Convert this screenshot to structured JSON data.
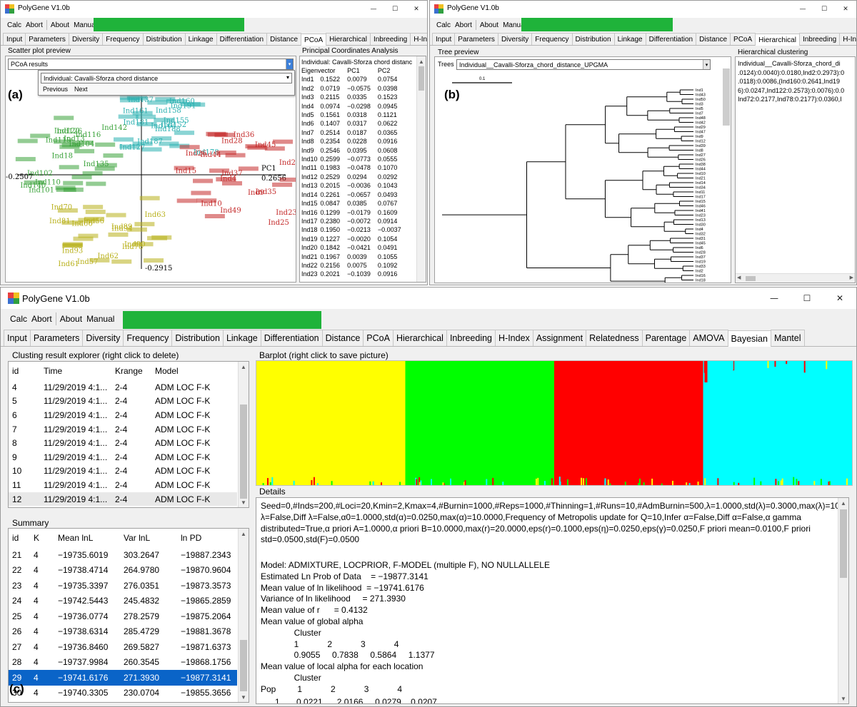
{
  "app_title": "PolyGene V1.0b",
  "menu": {
    "calc": "Calc",
    "abort": "Abort",
    "about": "About",
    "manual": "Manual"
  },
  "window_controls": {
    "minimize": "—",
    "maximize": "☐",
    "close": "✕"
  },
  "tabs_small_a": [
    "Input",
    "Parameters",
    "Diversity",
    "Frequency",
    "Distribution",
    "Linkage",
    "Differentiation",
    "Distance",
    "PCoA",
    "Hierarchical",
    "Inbreeding",
    "H-Inde"
  ],
  "tabs_small_b": [
    "Input",
    "Parameters",
    "Diversity",
    "Frequency",
    "Distribution",
    "Linkage",
    "Differentiation",
    "Distance",
    "PCoA",
    "Hierarchical",
    "Inbreeding",
    "H-Inde"
  ],
  "tabs_main": [
    "Input",
    "Parameters",
    "Diversity",
    "Frequency",
    "Distribution",
    "Linkage",
    "Differentiation",
    "Distance",
    "PCoA",
    "Hierarchical",
    "Inbreeding",
    "H-Index",
    "Assignment",
    "Relatedness",
    "Parentage",
    "AMOVA",
    "Bayesian",
    "Mantel"
  ],
  "panel_a": {
    "label": "(a)",
    "scatter_label": "Scatter plot preview",
    "pcoa_combo": "PCoA results",
    "dropdown_value": "Individual: Cavalli-Sforza chord distance",
    "previous": "Previous",
    "next": "Next",
    "axis_left": "-0.2507",
    "axis_right": "0.2656",
    "axis_pc1": "PC1",
    "axis_bottom": "-0.2915",
    "pca_title": "Principal Coordinates Analysis",
    "pca_subtitle": "Individual: Cavalli-Sforza chord distanc",
    "pca_header": [
      "Eigenvector",
      "PC1",
      "PC2"
    ],
    "pca_rows": [
      [
        "Ind1",
        "0.1522",
        "0.0079",
        "0.0754"
      ],
      [
        "Ind2",
        "0.0719",
        "−0.0575",
        "0.0398"
      ],
      [
        "Ind3",
        "0.2115",
        "0.0335",
        "0.1523"
      ],
      [
        "Ind4",
        "0.0974",
        "−0.0298",
        "0.0945"
      ],
      [
        "Ind5",
        "0.1561",
        "0.0318",
        "0.1121"
      ],
      [
        "Ind6",
        "0.1407",
        "0.0317",
        "0.0622"
      ],
      [
        "Ind7",
        "0.2514",
        "0.0187",
        "0.0365"
      ],
      [
        "Ind8",
        "0.2354",
        "0.0228",
        "0.0916"
      ],
      [
        "Ind9",
        "0.2546",
        "0.0395",
        "0.0608"
      ],
      [
        "Ind10",
        "0.2599",
        "−0.0773",
        "0.0555"
      ],
      [
        "Ind11",
        "0.1983",
        "−0.0478",
        "0.1070"
      ],
      [
        "Ind12",
        "0.2529",
        "0.0294",
        "0.0292"
      ],
      [
        "Ind13",
        "0.2015",
        "−0.0036",
        "0.1043"
      ],
      [
        "Ind14",
        "0.2261",
        "−0.0657",
        "0.0493"
      ],
      [
        "Ind15",
        "0.0847",
        "0.0385",
        "0.0767"
      ],
      [
        "Ind16",
        "0.1299",
        "−0.0179",
        "0.1609"
      ],
      [
        "Ind17",
        "0.2380",
        "−0.0072",
        "0.0914"
      ],
      [
        "Ind18",
        "0.1950",
        "−0.0213",
        "−0.0037"
      ],
      [
        "Ind19",
        "0.1227",
        "−0.0020",
        "0.1054"
      ],
      [
        "Ind20",
        "0.1842",
        "−0.0421",
        "0.0491"
      ],
      [
        "Ind21",
        "0.1967",
        "0.0039",
        "0.1055"
      ],
      [
        "Ind22",
        "0.2156",
        "0.0075",
        "0.1092"
      ],
      [
        "Ind23",
        "0.2021",
        "−0.1039",
        "0.0916"
      ]
    ],
    "scatter_points": [
      {
        "t": "Ind188",
        "c": "#2ab0b0"
      },
      {
        "t": "Ind161",
        "c": "#2ab0b0"
      },
      {
        "t": "Ind164",
        "c": "#2ab0b0"
      },
      {
        "t": "Ind127",
        "c": "#2ab0b0"
      },
      {
        "t": "Ind155",
        "c": "#2ab0b0"
      },
      {
        "t": "Ind187",
        "c": "#2ab0b0"
      },
      {
        "t": "Ind160",
        "c": "#2ab0b0"
      },
      {
        "t": "Ind158",
        "c": "#2ab0b0"
      },
      {
        "t": "Ind191",
        "c": "#2ab0b0"
      },
      {
        "t": "Ind152",
        "c": "#2ab0b0"
      },
      {
        "t": "Ind137",
        "c": "#2ab0b0"
      },
      {
        "t": "Ind178",
        "c": "#2ab0b0"
      },
      {
        "t": "Ind181",
        "c": "#2ab0b0"
      },
      {
        "t": "Ind142",
        "c": "#3aa23a"
      },
      {
        "t": "Ind18",
        "c": "#3aa23a"
      },
      {
        "t": "Ind116",
        "c": "#3aa23a"
      },
      {
        "t": "Ind101",
        "c": "#3aa23a"
      },
      {
        "t": "Ind120",
        "c": "#3aa23a"
      },
      {
        "t": "Ind13",
        "c": "#3aa23a"
      },
      {
        "t": "Ind102",
        "c": "#3aa23a"
      },
      {
        "t": "Ind119",
        "c": "#3aa23a"
      },
      {
        "t": "Ind140",
        "c": "#3aa23a"
      },
      {
        "t": "Ind110",
        "c": "#3aa23a"
      },
      {
        "t": "Ind126",
        "c": "#3aa23a"
      },
      {
        "t": "Ind104",
        "c": "#3aa23a"
      },
      {
        "t": "Ind135",
        "c": "#3aa23a"
      },
      {
        "t": "Ind26",
        "c": "#c42a2a"
      },
      {
        "t": "Ind28",
        "c": "#c42a2a"
      },
      {
        "t": "Ind15",
        "c": "#c42a2a"
      },
      {
        "t": "Ind9",
        "c": "#c42a2a"
      },
      {
        "t": "Ind2",
        "c": "#c42a2a"
      },
      {
        "t": "Ind4",
        "c": "#c42a2a"
      },
      {
        "t": "Ind49",
        "c": "#c42a2a"
      },
      {
        "t": "Ind37",
        "c": "#c42a2a"
      },
      {
        "t": "Ind44",
        "c": "#c42a2a"
      },
      {
        "t": "Ind45",
        "c": "#c42a2a"
      },
      {
        "t": "Ind10",
        "c": "#c42a2a"
      },
      {
        "t": "Ind25",
        "c": "#c42a2a"
      },
      {
        "t": "Ind23",
        "c": "#c42a2a"
      },
      {
        "t": "Ind35",
        "c": "#c42a2a"
      },
      {
        "t": "Ind36",
        "c": "#c42a2a"
      },
      {
        "t": "Ind56",
        "c": "#b8b01a"
      },
      {
        "t": "Ind66",
        "c": "#b8b01a"
      },
      {
        "t": "Ind78",
        "c": "#b8b01a"
      },
      {
        "t": "Ind57",
        "c": "#b8b01a"
      },
      {
        "t": "Ind81",
        "c": "#b8b01a"
      },
      {
        "t": "Ind89",
        "c": "#b8b01a"
      },
      {
        "t": "Ind61",
        "c": "#b8b01a"
      },
      {
        "t": "Ind62",
        "c": "#b8b01a"
      },
      {
        "t": "Ind94",
        "c": "#b8b01a"
      },
      {
        "t": "Ind93",
        "c": "#b8b01a"
      },
      {
        "t": "Ind63",
        "c": "#b8b01a"
      },
      {
        "t": "Ind70",
        "c": "#b8b01a"
      },
      {
        "t": "Ind90",
        "c": "#b8b01a"
      }
    ]
  },
  "panel_b": {
    "label": "(b)",
    "tree_label": "Tree preview",
    "trees_label": "Trees",
    "trees_value": "Individual__Cavalli-Sforza_chord_distance_UPGMA",
    "scale": "0.1",
    "clust_label": "Hierarchical clustering",
    "clust_lines": [
      "Individual__Cavalli-Sforza_chord_di",
      ".0124):0.0040):0.0180,Ind2:0.2973):0",
      ".0118):0.0086,(Ind160:0.2641,Ind19",
      "6):0.0247,Ind122:0.2573):0.0076):0.0",
      "Ind72:0.2177,Ind78:0.2177):0.0360,I"
    ],
    "leaves": [
      "Ind1",
      "Ind43",
      "Ind50",
      "Ind3",
      "Ind5",
      "Ind7",
      "Ind48",
      "Ind42",
      "Ind29",
      "Ind47",
      "Ind9",
      "Ind12",
      "Ind39",
      "Ind8",
      "Ind27",
      "Ind26",
      "Ind38",
      "Ind44",
      "Ind10",
      "Ind21",
      "Ind14",
      "Ind34",
      "Ind11",
      "Ind17",
      "Ind15",
      "Ind46",
      "Ind41",
      "Ind23",
      "Ind13",
      "Ind30",
      "Ind4",
      "Ind32",
      "Ind31",
      "Ind45",
      "Ind6",
      "Ind28",
      "Ind37",
      "Ind19",
      "Ind33",
      "Ind2",
      "Ind16",
      "Ind18",
      "Ind20"
    ]
  },
  "panel_c": {
    "label": "(c)",
    "explorer_label": "Clusting result explorer (right click to delete)",
    "explorer_headers": [
      "id",
      "Time",
      "Krange",
      "Model"
    ],
    "explorer_rows": [
      [
        "4",
        "11/29/2019 4:1...",
        "2-4",
        "ADM LOC F-K"
      ],
      [
        "5",
        "11/29/2019 4:1...",
        "2-4",
        "ADM LOC F-K"
      ],
      [
        "6",
        "11/29/2019 4:1...",
        "2-4",
        "ADM LOC F-K"
      ],
      [
        "7",
        "11/29/2019 4:1...",
        "2-4",
        "ADM LOC F-K"
      ],
      [
        "8",
        "11/29/2019 4:1...",
        "2-4",
        "ADM LOC F-K"
      ],
      [
        "9",
        "11/29/2019 4:1...",
        "2-4",
        "ADM LOC F-K"
      ],
      [
        "10",
        "11/29/2019 4:1...",
        "2-4",
        "ADM LOC F-K"
      ],
      [
        "11",
        "11/29/2019 4:1...",
        "2-4",
        "ADM LOC F-K"
      ],
      [
        "12",
        "11/29/2019 4:1...",
        "2-4",
        "ADM LOC F-K"
      ]
    ],
    "summary_label": "Summary",
    "summary_headers": [
      "id",
      "K",
      "Mean lnL",
      "Var lnL",
      "ln PD"
    ],
    "summary_rows": [
      [
        "21",
        "4",
        "−19735.6019",
        "303.2647",
        "−19887.2343"
      ],
      [
        "22",
        "4",
        "−19738.4714",
        "264.9780",
        "−19870.9604"
      ],
      [
        "23",
        "4",
        "−19735.3397",
        "276.0351",
        "−19873.3573"
      ],
      [
        "24",
        "4",
        "−19742.5443",
        "245.4832",
        "−19865.2859"
      ],
      [
        "25",
        "4",
        "−19736.0774",
        "278.2579",
        "−19875.2064"
      ],
      [
        "26",
        "4",
        "−19738.6314",
        "285.4729",
        "−19881.3678"
      ],
      [
        "27",
        "4",
        "−19736.8460",
        "269.5827",
        "−19871.6373"
      ],
      [
        "28",
        "4",
        "−19737.9984",
        "260.3545",
        "−19868.1756"
      ],
      [
        "29",
        "4",
        "−19741.6176",
        "271.3930",
        "−19877.3141"
      ],
      [
        "30",
        "4",
        "−19740.3305",
        "230.0704",
        "−19855.3656"
      ]
    ],
    "summary_selected": 8,
    "barplot_label": "Barplot (right click to save picture)",
    "bar_colors": [
      "#ffff00",
      "#00ff00",
      "#ff0000",
      "#00ffff"
    ],
    "details_label": "Details",
    "details_text": "Seed=0,#Inds=200,#Loci=20,Kmin=2,Kmax=4,#Burnin=1000,#Reps=1000,#Thinning=1,#Runs=10,#AdmBurnin=500,λ=1.0000,std(λ)=0.3000,max(λ)=10.0000,Infer λ=False,Diff λ=False,α0=1.0000,std(α)=0.0250,max(α)=10.0000,Frequency of Metropolis update for Q=10,Infer α=False,Diff α=False,α gamma distributed=True,α priori A=1.0000,α priori B=10.0000,max(r)=20.0000,eps(r)=0.1000,eps(η)=0.0250,eps(γ)=0.0250,F priori mean=0.0100,F priori std=0.0500,std(F)=0.0500",
    "details_lines": [
      "Model: ADMIXTURE, LOCPRIOR, F-MODEL (multiple F), NO NULLALLELE",
      "Estimated Ln Prob of Data    = −19877.3141",
      "Mean value of ln likelihood  = −19741.6176",
      "Variance of ln likelihood     = 271.3930",
      "Mean value of r      = 0.4132",
      "Mean value of global alpha",
      "              Cluster",
      "              1            2            3            4",
      "              0.9055     0.7838     0.5864     1.1377",
      "Mean value of local alpha for each location",
      "              Cluster",
      "Pop         1            2            3            4"
    ]
  }
}
